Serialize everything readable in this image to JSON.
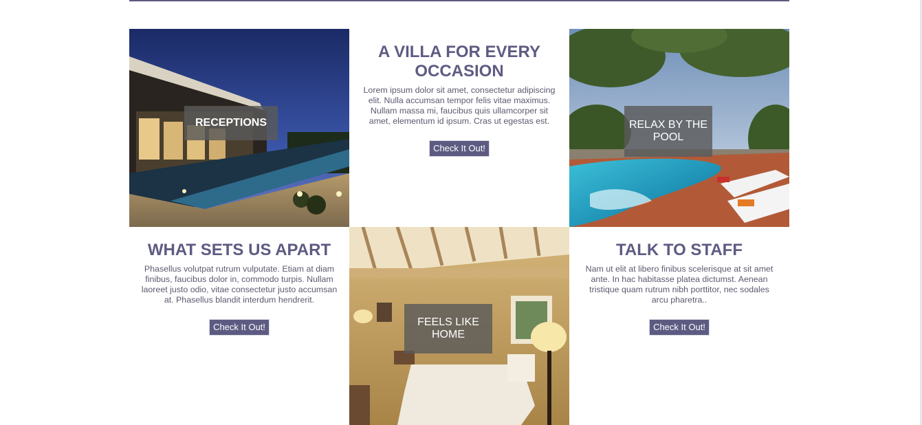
{
  "tiles": {
    "receptions": {
      "caption": "RECEPTIONS"
    },
    "villa": {
      "heading": "A VILLA FOR EVERY OCCASION",
      "body": "Lorem ipsum dolor sit amet, consectetur adipiscing elit. Nulla accumsan tempor felis vitae maximus. Nullam massa mi, faucibus quis ullamcorper sit amet, elementum id ipsum. Cras ut egestas est.",
      "button": "Check It Out!"
    },
    "pool": {
      "caption": "RELAX BY THE POOL"
    },
    "apart": {
      "heading": "WHAT SETS US APART",
      "body": "Phasellus volutpat rutrum vulputate. Etiam at diam finibus, faucibus dolor in, commodo turpis. Nullam laoreet justo odio, vitae consectetur justo accumsan at. Phasellus blandit interdum hendrerit.",
      "button": "Check It Out!"
    },
    "home": {
      "caption": "FEELS LIKE HOME"
    },
    "staff": {
      "heading": "TALK TO STAFF",
      "body": "Nam ut elit at libero finibus scelerisque at sit amet ante. In hac habitasse platea dictumst. Aenean tristique quam rutrum nibh porttitor, nec sodales arcu pharetra..",
      "button": "Check It Out!"
    }
  },
  "colors": {
    "accent": "#5d5b82",
    "caption_bg": "#5a5a5a"
  }
}
